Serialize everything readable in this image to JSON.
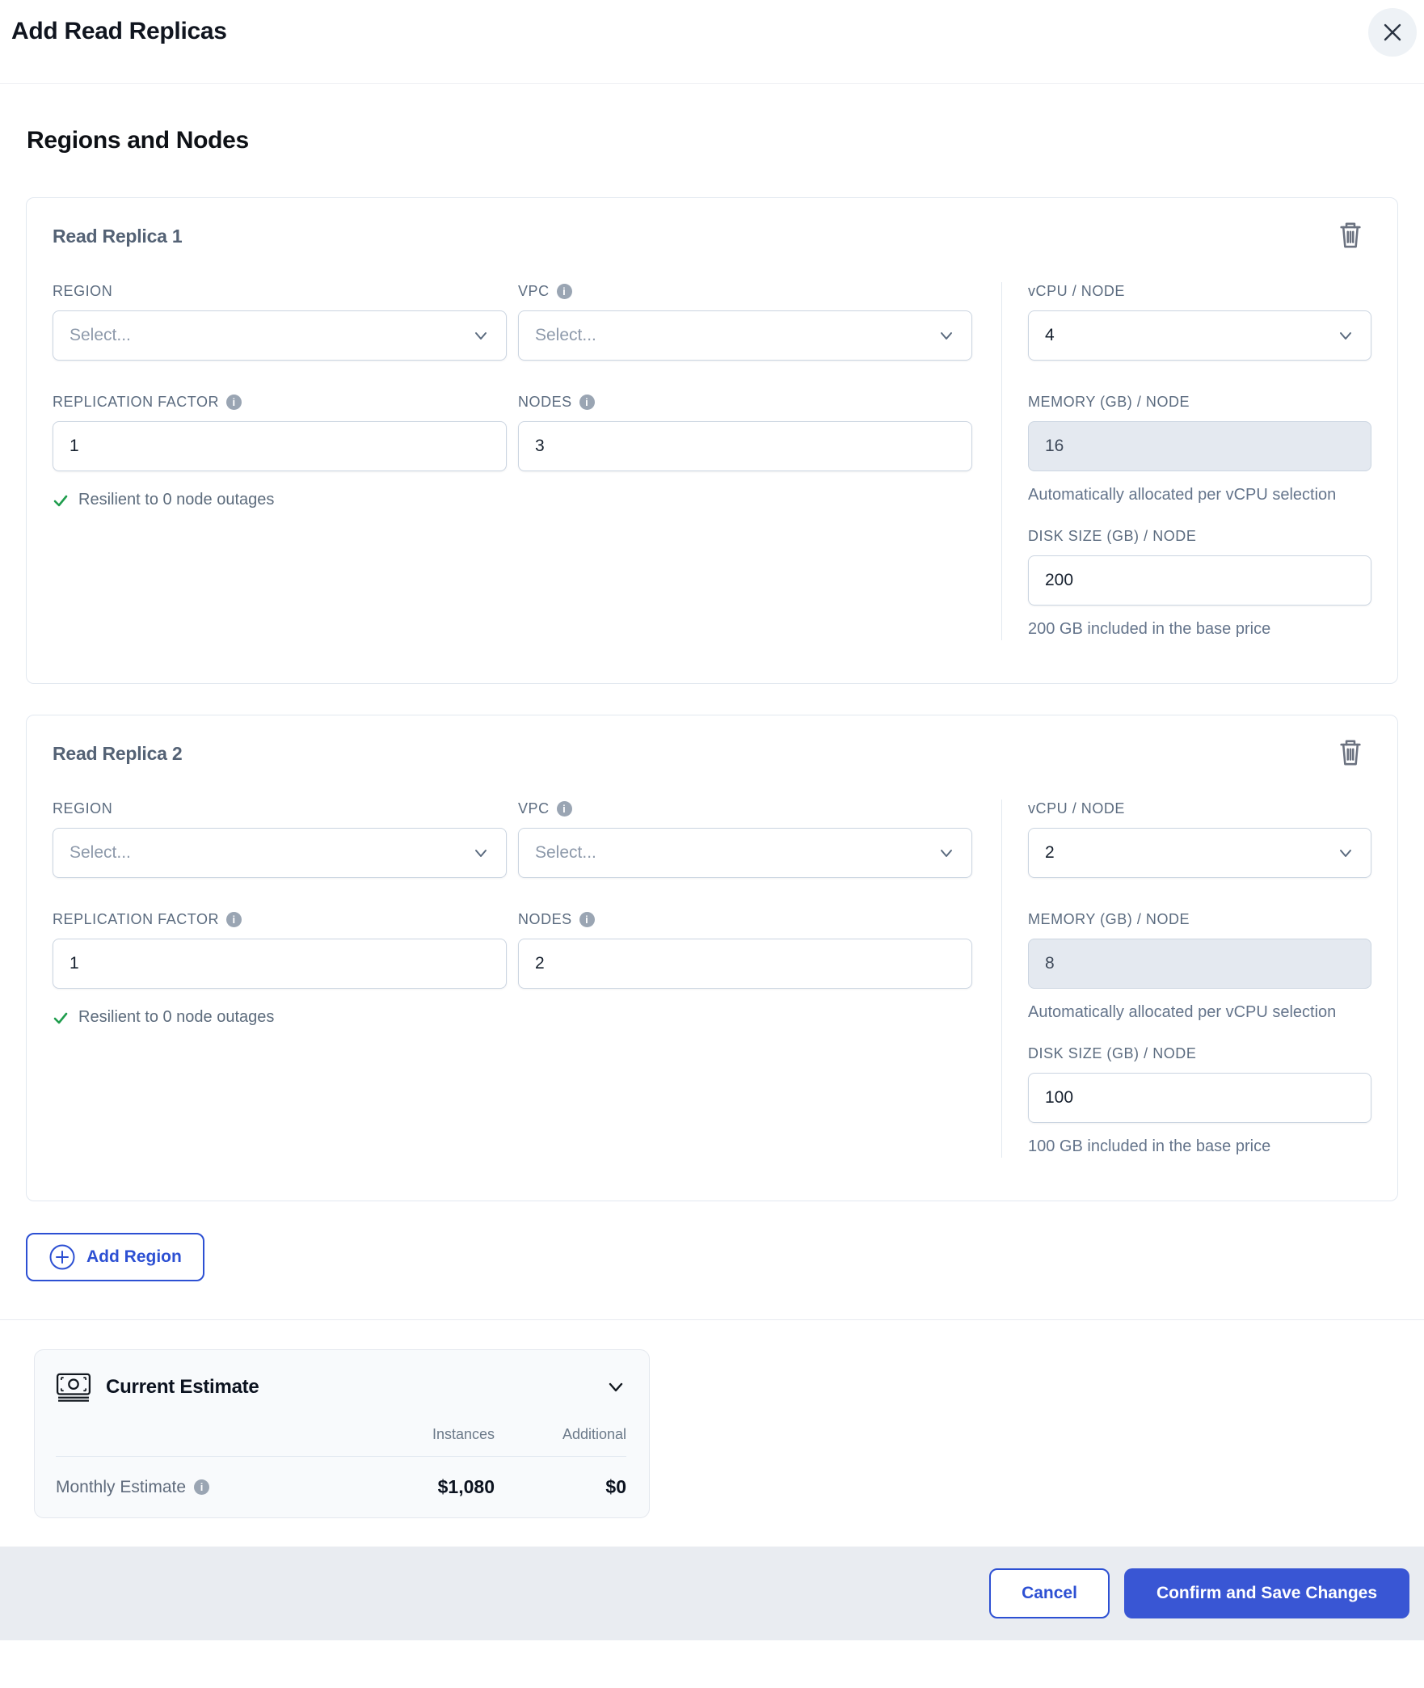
{
  "modal": {
    "title": "Add Read Replicas"
  },
  "section_title": "Regions and Nodes",
  "field_labels": {
    "region": "REGION",
    "vpc": "VPC",
    "replication_factor": "REPLICATION FACTOR",
    "nodes": "NODES",
    "vcpu": "vCPU / NODE",
    "memory": "MEMORY (GB) / NODE",
    "disk": "DISK SIZE (GB) / NODE"
  },
  "replicas": [
    {
      "title": "Read Replica 1",
      "region_value": "Select...",
      "vpc_value": "Select...",
      "replication_factor": "1",
      "nodes": "3",
      "resilience_note": "Resilient to 0 node outages",
      "vcpu": "4",
      "memory": "16",
      "memory_note": "Automatically allocated per vCPU selection",
      "disk_size": "200",
      "disk_note": "200 GB included in the base price"
    },
    {
      "title": "Read Replica 2",
      "region_value": "Select...",
      "vpc_value": "Select...",
      "replication_factor": "1",
      "nodes": "2",
      "resilience_note": "Resilient to 0 node outages",
      "vcpu": "2",
      "memory": "8",
      "memory_note": "Automatically allocated per vCPU selection",
      "disk_size": "100",
      "disk_note": "100 GB included in the base price"
    }
  ],
  "add_region_label": "Add Region",
  "estimate": {
    "title": "Current Estimate",
    "columns": {
      "instances": "Instances",
      "additional": "Additional"
    },
    "row": {
      "label": "Monthly Estimate",
      "instances": "$1,080",
      "additional": "$0"
    }
  },
  "footer": {
    "cancel_label": "Cancel",
    "confirm_label": "Confirm and Save Changes"
  },
  "icons": {
    "close": "x-icon",
    "delete": "trash-icon",
    "info": "info-icon",
    "dropdown": "chevron-down-icon",
    "add": "plus-circle-icon",
    "estimate": "banknote-icon",
    "resilient": "check-icon"
  },
  "colors": {
    "accent_blue": "#2d50d3",
    "confirm_blue": "#3956d4",
    "success_green": "#1f9d4d",
    "label_gray": "#5b6b7f",
    "border_gray": "#cbd5e1",
    "disabled_bg": "#e4e9f0",
    "footer_bar_bg": "#e9ecf1",
    "estimate_card_bg": "#f8fafc"
  }
}
